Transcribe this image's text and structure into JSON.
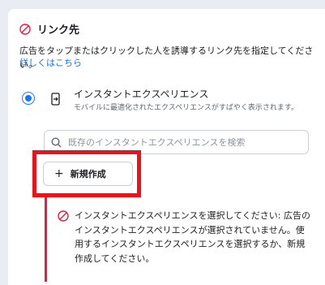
{
  "section": {
    "title": "リンク先",
    "description": "広告をタップまたはクリックした人を誘導するリンク先を指定してください。",
    "learn_more": "詳しくはこちら",
    "warning_color": "#e41e3f",
    "link_color": "#216fdb"
  },
  "option": {
    "icon": "instant-experience-icon",
    "label": "インスタントエクスペリエンス",
    "sublabel": "モバイルに最適化されたエクスペリエンスがすばやく表示されます。",
    "selected": true
  },
  "search": {
    "icon": "search-icon",
    "placeholder": "既存のインスタントエクスペリエンスを検索"
  },
  "new_button": {
    "icon": "plus-icon",
    "plus": "+",
    "label": "新規作成"
  },
  "error": {
    "icon": "error-circle-icon",
    "message": "インスタントエクスペリエンスを選択してください: 広告のインスタントエクスペリエンスが選択されていません。使用するインスタントエクスペリエンスを選択するか、新規作成してください。"
  }
}
